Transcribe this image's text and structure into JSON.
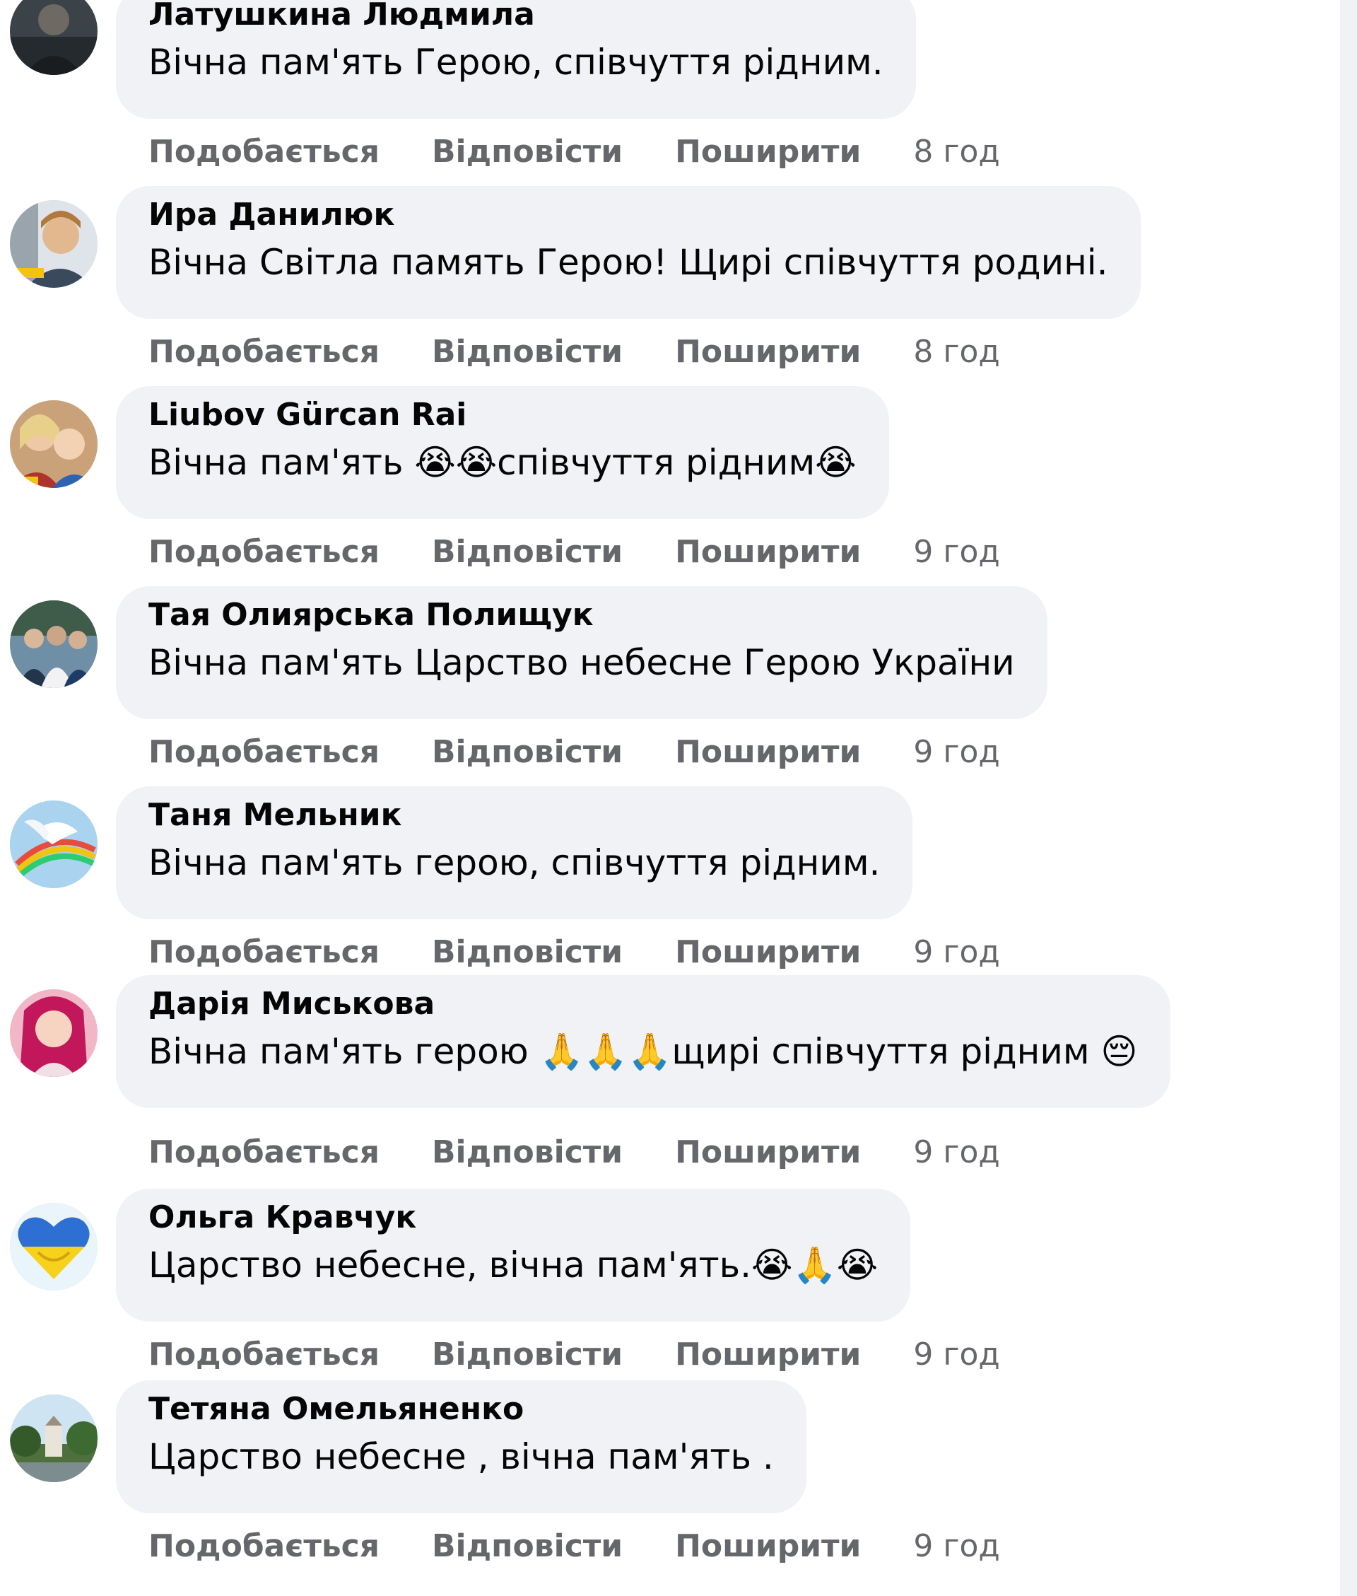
{
  "actions": {
    "like_label": "Подобається",
    "reply_label": "Відповісти",
    "share_label": "Поширити"
  },
  "comments": [
    {
      "author": "Латушкина Людмила",
      "text": "Вічна пам'ять Герою, співчуття рідним.",
      "time": "8 год",
      "avatar_icon": "person-photo-avatar"
    },
    {
      "author": "Ира Данилюк",
      "text": "Вічна Світла память Герою! Щирі співчуття родині.",
      "time": "8 год",
      "avatar_icon": "person-photo-avatar"
    },
    {
      "author": "Liubov Gürcan Rai",
      "text": "Вічна пам'ять 😭😭співчуття рідним😭",
      "time": "9 год",
      "avatar_icon": "family-photo-avatar"
    },
    {
      "author": "Тая Олиярська Полищук",
      "text": "Вічна пам'ять Царство небесне Герою України",
      "time": "9 год",
      "avatar_icon": "group-photo-avatar"
    },
    {
      "author": "Таня Мельник",
      "text": "Вічна пам'ять герою, співчуття рідним.",
      "time": "9 год",
      "avatar_icon": "dove-avatar"
    },
    {
      "author": "Дарія Миськова",
      "text": "Вічна пам'ять герою 🙏🙏🙏щирі співчуття рідним 😔",
      "time": "9 год",
      "avatar_icon": "person-photo-avatar"
    },
    {
      "author": "Ольга Кравчук",
      "text": "Царство небесне, вічна пам'ять.😭🙏😭",
      "time": "9 год",
      "avatar_icon": "ukraine-heart-avatar"
    },
    {
      "author": "Тетяна Омельяненко",
      "text": "Царство небесне , вічна пам'ять .",
      "time": "9 год",
      "avatar_icon": "landscape-photo-avatar"
    }
  ]
}
